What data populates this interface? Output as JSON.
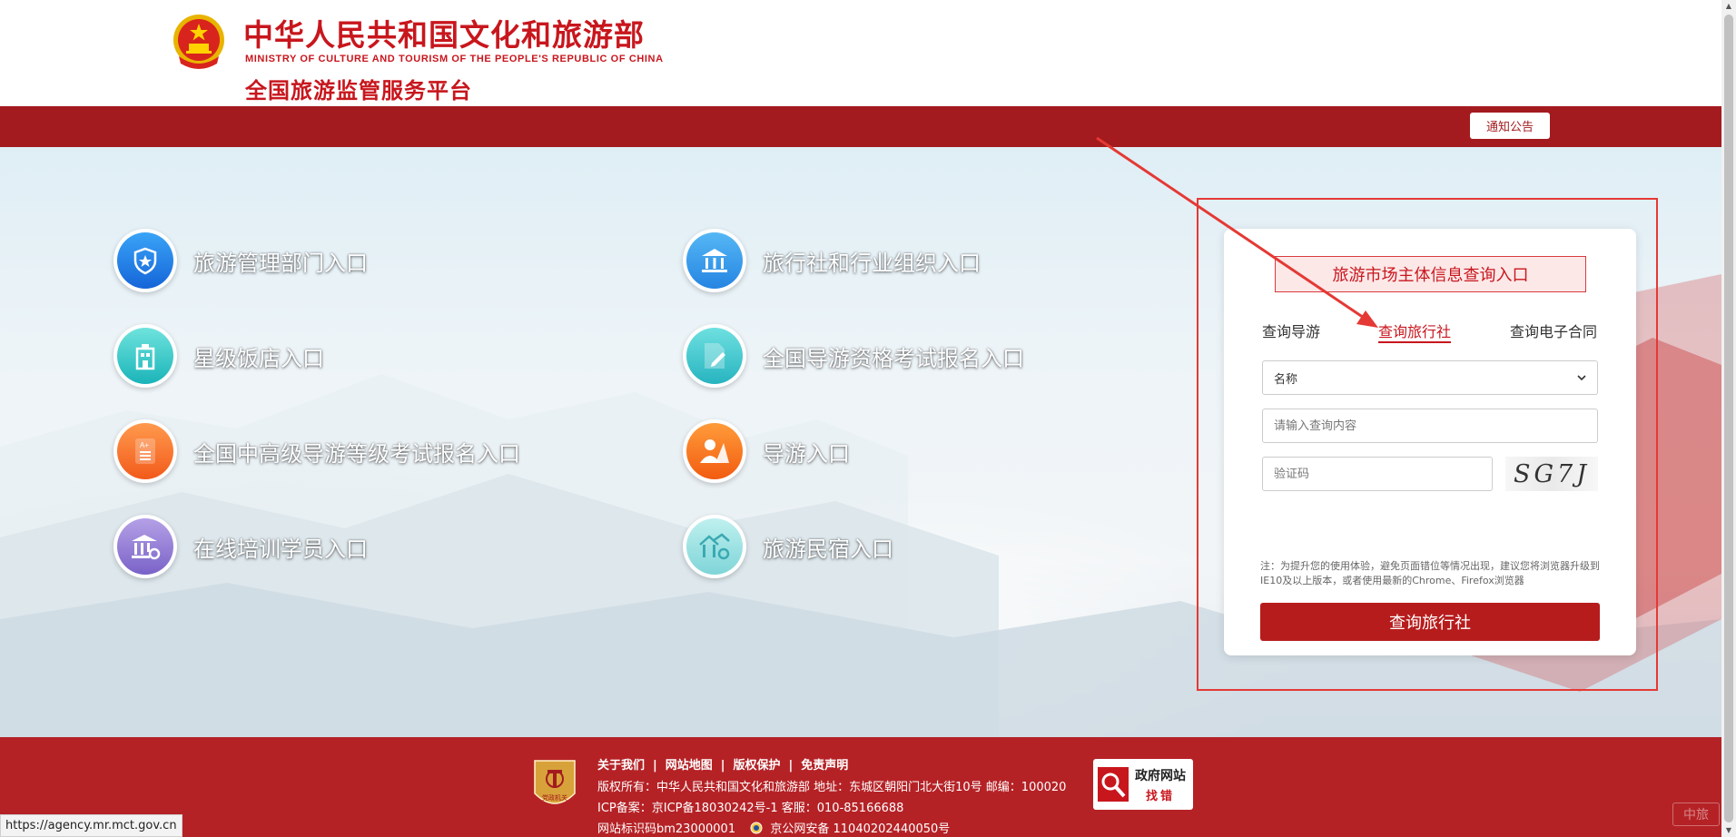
{
  "header": {
    "ministry_cn": "中华人民共和国文化和旅游部",
    "ministry_en": "MINISTRY OF CULTURE AND TOURISM OF THE PEOPLE'S REPUBLIC OF CHINA",
    "platform": "全国旅游监管服务平台",
    "notice_button": "通知公告"
  },
  "entries": [
    {
      "label": "旅游管理部门入口",
      "icon": "shield-icon"
    },
    {
      "label": "星级饭店入口",
      "icon": "hotel-icon"
    },
    {
      "label": "全国中高级导游等级考试报名入口",
      "icon": "exam-doc-icon"
    },
    {
      "label": "在线培训学员入口",
      "icon": "training-icon"
    },
    {
      "label": "旅行社和行业组织入口",
      "icon": "agency-building-icon"
    },
    {
      "label": "全国导游资格考试报名入口",
      "icon": "edit-doc-icon"
    },
    {
      "label": "导游入口",
      "icon": "guide-icon"
    },
    {
      "label": "旅游民宿入口",
      "icon": "homestay-icon"
    }
  ],
  "query": {
    "title": "旅游市场主体信息查询入口",
    "tabs": [
      "查询导游",
      "查询旅行社",
      "查询电子合同"
    ],
    "active_tab": "查询旅行社",
    "select_value": "名称",
    "search_placeholder": "请输入查询内容",
    "captcha_placeholder": "验证码",
    "captcha_code": "SG7J",
    "note": "注：为提升您的使用体验，避免页面错位等情况出现，建议您将浏览器升级到IE10及以上版本，或者使用最新的Chrome、Firefox浏览器",
    "submit_label": "查询旅行社"
  },
  "footer": {
    "links": [
      "关于我们",
      "网站地图",
      "版权保护",
      "免责声明"
    ],
    "copyright": "版权所有：中华人民共和国文化和旅游部 地址：东城区朝阳门北大街10号 邮编：100020",
    "icp": "ICP备案：京ICP备18030242号-1 客服：010-85166688",
    "site_id": "网站标识码bm23000001",
    "police": "京公网安备 11040202440050号",
    "party_logo_text": "党政机关",
    "gov_badge_line1": "政府网站",
    "gov_badge_line2": "找错"
  },
  "status_url": "https://agency.mr.mct.gov.cn",
  "watermark": "中旅",
  "colors": {
    "brand_red": "#c8161d",
    "nav_red": "#a31b1f",
    "footer_red": "#b52226",
    "highlight": "#e53935"
  }
}
